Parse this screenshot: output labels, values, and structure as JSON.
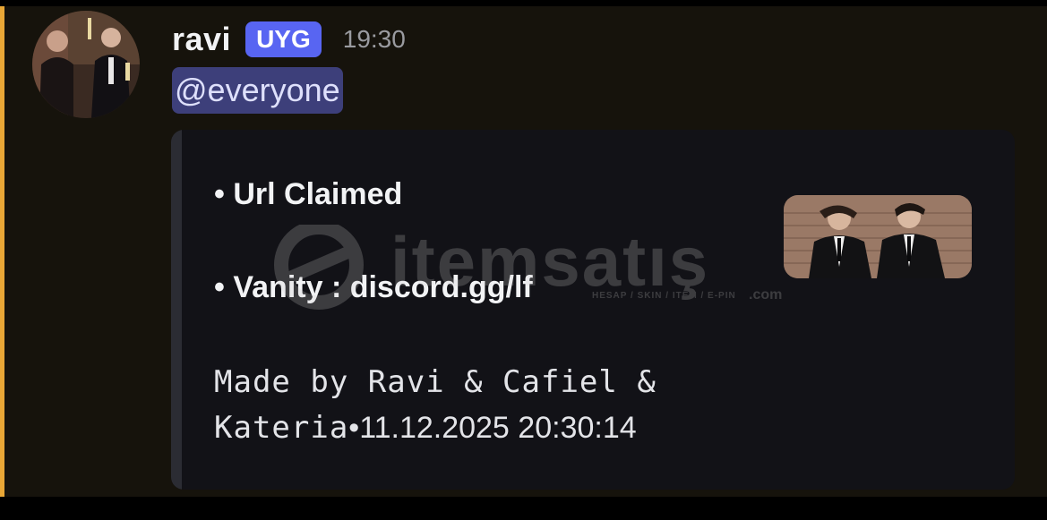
{
  "message": {
    "username": "ravi",
    "tag": "UYG",
    "timestamp": "19:30",
    "mention": "@everyone",
    "accent_color": "#e9a736"
  },
  "embed": {
    "line1": "• Url Claimed",
    "line2": "• Vanity : discord.gg/lf",
    "footer_mono_1": "Made by Ravi & Cafiel &",
    "footer_mono_2": "Kateria",
    "footer_sep": "•",
    "footer_date": "11.12.2025 20:30:14"
  },
  "watermark": {
    "brand": "itemsatış",
    "subtitle": "HESAP / SKIN / ITEM / E-PIN",
    "domain": ".com"
  }
}
